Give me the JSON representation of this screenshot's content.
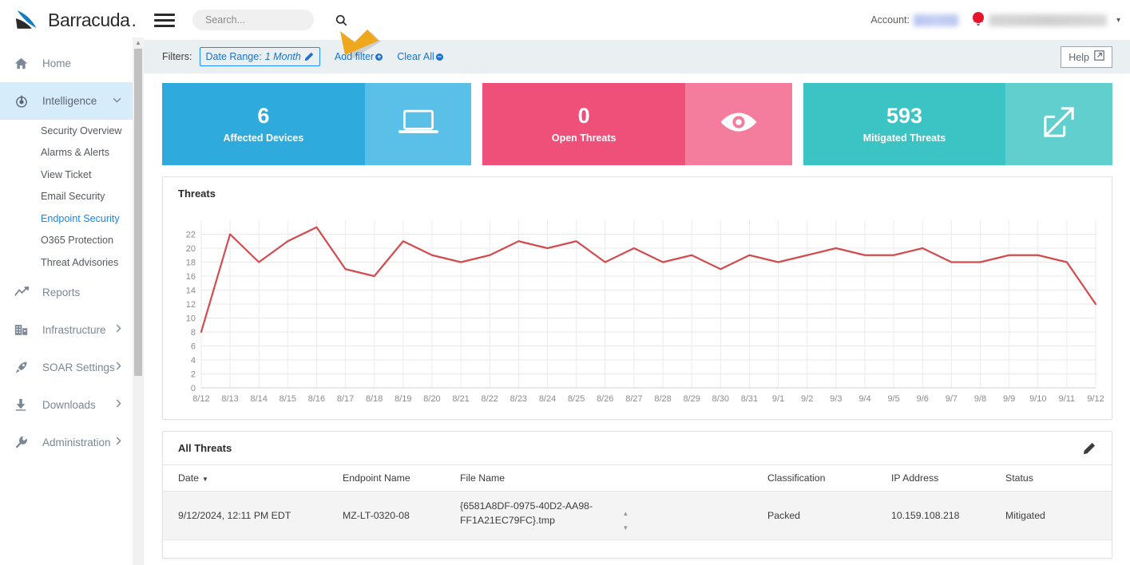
{
  "brand": {
    "name": "Barracuda",
    "name_suffix": ".",
    "accent": "#0f7fc4"
  },
  "topbar": {
    "menu_icon": "hamburger-icon",
    "search": {
      "placeholder": "Search...",
      "value": "",
      "icon": "search-icon"
    },
    "account_label": "Account:",
    "account_value_redacted": true,
    "notification_icon": "bell-icon",
    "user_name_redacted": true,
    "user_caret": "▾"
  },
  "sidebar": {
    "items": [
      {
        "label": "Home",
        "icon": "home-icon",
        "active": false,
        "caret": ""
      },
      {
        "label": "Intelligence",
        "icon": "target-icon",
        "active": true,
        "caret": "∨"
      },
      {
        "label": "Reports",
        "icon": "trend-icon",
        "active": false,
        "caret": ""
      },
      {
        "label": "Infrastructure",
        "icon": "building-icon",
        "active": false,
        "caret": "›"
      },
      {
        "label": "SOAR Settings",
        "icon": "rocket-icon",
        "active": false,
        "caret": "›"
      },
      {
        "label": "Downloads",
        "icon": "download-icon",
        "active": false,
        "caret": "›"
      },
      {
        "label": "Administration",
        "icon": "wrench-icon",
        "active": false,
        "caret": "›"
      }
    ],
    "subitems": [
      {
        "label": "Security Overview",
        "selected": false
      },
      {
        "label": "Alarms & Alerts",
        "selected": false
      },
      {
        "label": "View Ticket",
        "selected": false
      },
      {
        "label": "Email Security",
        "selected": false
      },
      {
        "label": "Endpoint Security",
        "selected": true
      },
      {
        "label": "O365 Protection",
        "selected": false
      },
      {
        "label": "Threat Advisories",
        "selected": false
      }
    ]
  },
  "filterbar": {
    "filters_label": "Filters:",
    "date_range_label": "Date Range:",
    "date_range_value": "1 Month",
    "edit_icon": "pencil-icon",
    "add_filter_label": "Add filter",
    "add_filter_icon": "plus-circle-icon",
    "clear_all_label": "Clear All",
    "clear_all_icon": "minus-circle-icon",
    "help_label": "Help",
    "help_icon": "external-link-icon"
  },
  "kpis": [
    {
      "value": "6",
      "caption": "Affected Devices",
      "icon": "laptop-icon",
      "color_main": "#2FAADC",
      "color_icon": "#5BC0E8"
    },
    {
      "value": "0",
      "caption": "Open Threats",
      "icon": "eye-icon",
      "color_main": "#EE5079",
      "color_icon": "#F47C9C"
    },
    {
      "value": "593",
      "caption": "Mitigated Threats",
      "icon": "external-link-icon",
      "color_main": "#3CC3C3",
      "color_icon": "#62CFCF"
    }
  ],
  "chart_panel": {
    "title": "Threats"
  },
  "chart_data": {
    "type": "line",
    "title": "Threats",
    "xlabel": "",
    "ylabel": "",
    "ylim": [
      0,
      24
    ],
    "yticks": [
      0,
      2,
      4,
      6,
      8,
      10,
      12,
      14,
      16,
      18,
      20,
      22
    ],
    "grid": true,
    "legend": "none",
    "line_color": "#d24b4e",
    "categories": [
      "8/12",
      "8/13",
      "8/14",
      "8/15",
      "8/16",
      "8/17",
      "8/18",
      "8/19",
      "8/20",
      "8/21",
      "8/22",
      "8/23",
      "8/24",
      "8/25",
      "8/26",
      "8/27",
      "8/28",
      "8/29",
      "8/30",
      "8/31",
      "9/1",
      "9/2",
      "9/3",
      "9/4",
      "9/5",
      "9/6",
      "9/7",
      "9/8",
      "9/9",
      "9/10",
      "9/11",
      "9/12"
    ],
    "values": [
      8,
      22,
      18,
      21,
      23,
      17,
      16,
      21,
      19,
      18,
      19,
      21,
      20,
      21,
      18,
      20,
      18,
      19,
      17,
      19,
      18,
      19,
      20,
      19,
      19,
      20,
      18,
      18,
      19,
      19,
      18,
      12
    ]
  },
  "table_panel": {
    "title": "All Threats",
    "edit_icon": "pencil-icon",
    "columns": [
      "Date",
      "Endpoint Name",
      "File Name",
      "",
      "Classification",
      "IP Address",
      "Status"
    ],
    "sort_column": "Date",
    "sort_direction": "▼",
    "rows": [
      {
        "date": "9/12/2024, 12:11 PM EDT",
        "endpoint_name": "MZ-LT-0320-08",
        "file_name": "{6581A8DF-0975-40D2-AA98-FF1A21EC79FC}.tmp",
        "classification": "Packed",
        "ip_address": "10.159.108.218",
        "status": "Mitigated"
      }
    ]
  },
  "annotation": {
    "type": "arrow",
    "color": "#EFA81E",
    "points_to": "add-filter-link"
  }
}
